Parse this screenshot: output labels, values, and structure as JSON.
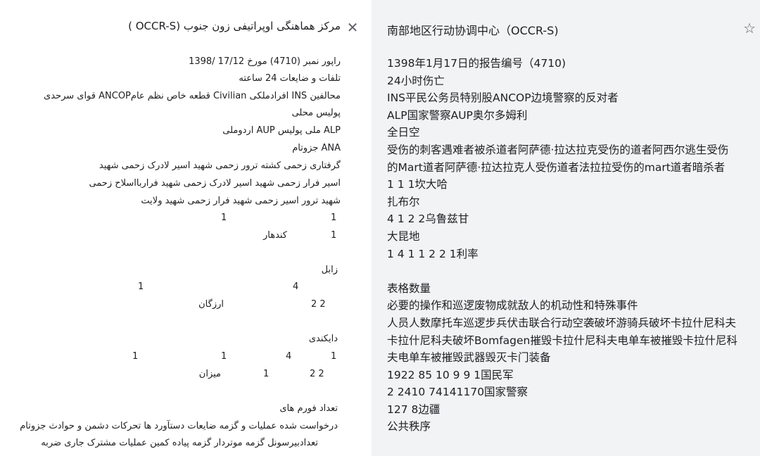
{
  "left": {
    "header": "مرکز هماهنگی اوپراتیفی زون جنوب (OCCR-S )",
    "lines": [
      "راپور نمبر (4710) مورخ 17/12 /1398",
      "تلفات و ضایعات 24 ساعته",
      "محالفین INS      افرادملکی Civilian قطعه خاص نظم عامANCOP      قوای سرحدی",
      "پولیس محلی",
      "ALP      ملی پولیس AUP      اردوملی",
      "ANA      جزوتام",
      "گرفتاری     زحمی     کشته ترور زحمی     شهید اسیر لادرک     زحمی     شهید",
      "اسیر   فرار زحمی     شهید اسیر لادرک     زحمی     شهید     فراربااسلاح زحمی",
      "شهید ترور اسیر زحمی     شهید فرار زحمی     شهید ولایت",
      "1",
      "1",
      "1",
      "کندهار",
      "زابل",
      "4",
      "1",
      "2   2",
      "ارزگان",
      "دایکندی",
      "1",
      "4",
      "1",
      "1",
      "2   2",
      "1",
      "میزان",
      "تعداد فورم های",
      "درخواست شده     عملیات و گزمه     ضایعات     دستآورد ها تحرکات دشمن و حوادث جزوتام",
      "تعدادبیرسونل     گزمه موتردار     گزمه پیاده  کمین عملیات مشترک جاری  ضربه"
    ]
  },
  "right": {
    "header": "南部地区行动协调中心（OCCR-S)",
    "lines": [
      "1398年1月17日的报告编号（4710)",
      "24小时伤亡",
      "INS平民公务员特别股ANCOP边境警察的反对者",
      "ALP国家警察AUP奥尔多姆利",
      "全日空",
      "受伤的刺客遇难者被杀道者阿萨德·拉达拉克受伤的道者阿西尔逃生受伤的Mart道者阿萨德·拉达拉克人受伤道者法拉拉受伤的mart道者暗杀者",
      "1 1 1坎大哈",
      "扎布尔",
      "4 1 2 2乌鲁兹甘",
      "大昆地",
      "1 4 1 1 2 2 1利率",
      "",
      "表格数量",
      "必要的操作和巡逻废物成就敌人的机动性和特殊事件",
      "人员人数摩托车巡逻步兵伏击联合行动空袭破坏游骑兵破坏卡拉什尼科夫卡拉什尼科夫破坏Bomfagen摧毁卡拉什尼科夫电单车被摧毁卡拉什尼科夫电单车被摧毁武器毁灭卡门装备",
      "1922 85 10 9 9 1国民军",
      "2 2410 74141170国家警察",
      "127 8边疆",
      "公共秩序"
    ]
  }
}
